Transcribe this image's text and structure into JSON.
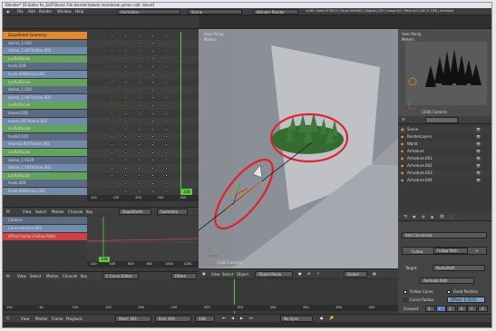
{
  "window": {
    "title": "Blender* [D:\\bidar fix_EdiT\\Revisi File blender\\bakek mendesak pohon edit .blend]"
  },
  "topbar": {
    "menus": [
      "File",
      "Add",
      "Render",
      "Window",
      "Help"
    ],
    "screen": "Animation",
    "scene": "Scene",
    "engine": "Blender Render",
    "stats": "v2.65 | Verts:3279213 | Faces:3563463 | Objects:1/35 | Lamps:0/1 | Mem:441.11M (1.11M) | Armature"
  },
  "dopesheet": {
    "channels": [
      {
        "label": "DopeSheet Summary",
        "kind": "summary"
      },
      {
        "label": "daima_1.026",
        "kind": "obj"
      },
      {
        "label": "daima_1.007Action.002",
        "kind": "act"
      },
      {
        "label": "LocRotScale",
        "kind": "grp"
      },
      {
        "label": "trunk.028",
        "kind": "obj"
      },
      {
        "label": "trunk.009Action.001",
        "kind": "act"
      },
      {
        "label": "LocRotScale",
        "kind": "grp"
      },
      {
        "label": "daima_1.020",
        "kind": "obj"
      },
      {
        "label": "daima_1.007Action.002",
        "kind": "act"
      },
      {
        "label": "LocRotScale",
        "kind": "grp"
      },
      {
        "label": "leaves.028",
        "kind": "obj"
      },
      {
        "label": "leaves.007Action.002",
        "kind": "act"
      },
      {
        "label": "LocRotScale",
        "kind": "grp"
      },
      {
        "label": "trunk2.020",
        "kind": "obj"
      },
      {
        "label": "leaves2.007Action.002",
        "kind": "act"
      },
      {
        "label": "LocRotScale",
        "kind": "grp"
      },
      {
        "label": "daima_1.0229",
        "kind": "obj"
      },
      {
        "label": "daima_1.005Action.002",
        "kind": "act"
      },
      {
        "label": "LocRotScale",
        "kind": "grp"
      },
      {
        "label": "trunk.029",
        "kind": "obj"
      },
      {
        "label": "trunk.009Action.002",
        "kind": "act"
      }
    ],
    "ruler": [
      "100",
      "150",
      "200",
      "250",
      "300"
    ],
    "frame_badge": "338",
    "header": {
      "items": [
        "View",
        "Select",
        "Marker",
        "Channel",
        "Key"
      ],
      "mode": "DopeSheet",
      "summary": "Summary"
    }
  },
  "nla": {
    "channels": [
      {
        "label": "Camera",
        "kind": "obj"
      },
      {
        "label": "CameraAction.002",
        "kind": "act"
      },
      {
        "label": "Offset Factor (Follow Path)",
        "kind": "red"
      }
    ],
    "ruler": [
      "200",
      "400",
      "600",
      "800",
      "1000",
      "1200"
    ],
    "frame_badge": "338",
    "header": {
      "items": [
        "View",
        "Select",
        "Marker",
        "Channel",
        "Key"
      ],
      "mode": "F-Curve Editor",
      "filters": "Filters"
    }
  },
  "viewport": {
    "label": "User Persp",
    "sublabel": "Meters",
    "object_label": "(338) Camera",
    "header": {
      "items": [
        "View",
        "Select",
        "Object"
      ],
      "mode": "Object Mode",
      "orientation": "Global"
    }
  },
  "timeline": {
    "ruler": [
      "100",
      "50",
      "100",
      "150",
      "200",
      "250",
      "300",
      "350",
      "400",
      "450",
      "500",
      "550"
    ],
    "header": {
      "items": [
        "View",
        "Marker",
        "Frame",
        "Playback"
      ],
      "start": "Start: 361",
      "end": "End: 454",
      "current": "338",
      "sync": "No Sync"
    }
  },
  "camview": {
    "label": "User Persp",
    "sublabel": "Meters",
    "object_label": "(338) Camera"
  },
  "outliner": {
    "items": [
      "Scene",
      "RenderLayers",
      "World",
      "Armature",
      "Armature.001",
      "Armature.002",
      "Armature.003",
      "Armature.004"
    ]
  },
  "props": {
    "add_constraint": "Add Constraint",
    "constraint_name": "Follow Path",
    "constraint_type": "Follow",
    "target_label": "Target:",
    "target_value": "NurbsPath",
    "animate_path": "Animate Path",
    "follow_curve": "Follow Curve",
    "fixed_position": "Fixed Position",
    "curve_radius": "Curve Radius",
    "offset": "Offset: 0.0255",
    "forward_label": "Forward:",
    "axes": [
      "X",
      "Y",
      "Z",
      "-X",
      "-Y",
      "-Z"
    ]
  },
  "colors": {
    "highlight_red": "#e0232b",
    "key_yellow": "#e9d85c",
    "frame_green": "#5dcc44"
  }
}
